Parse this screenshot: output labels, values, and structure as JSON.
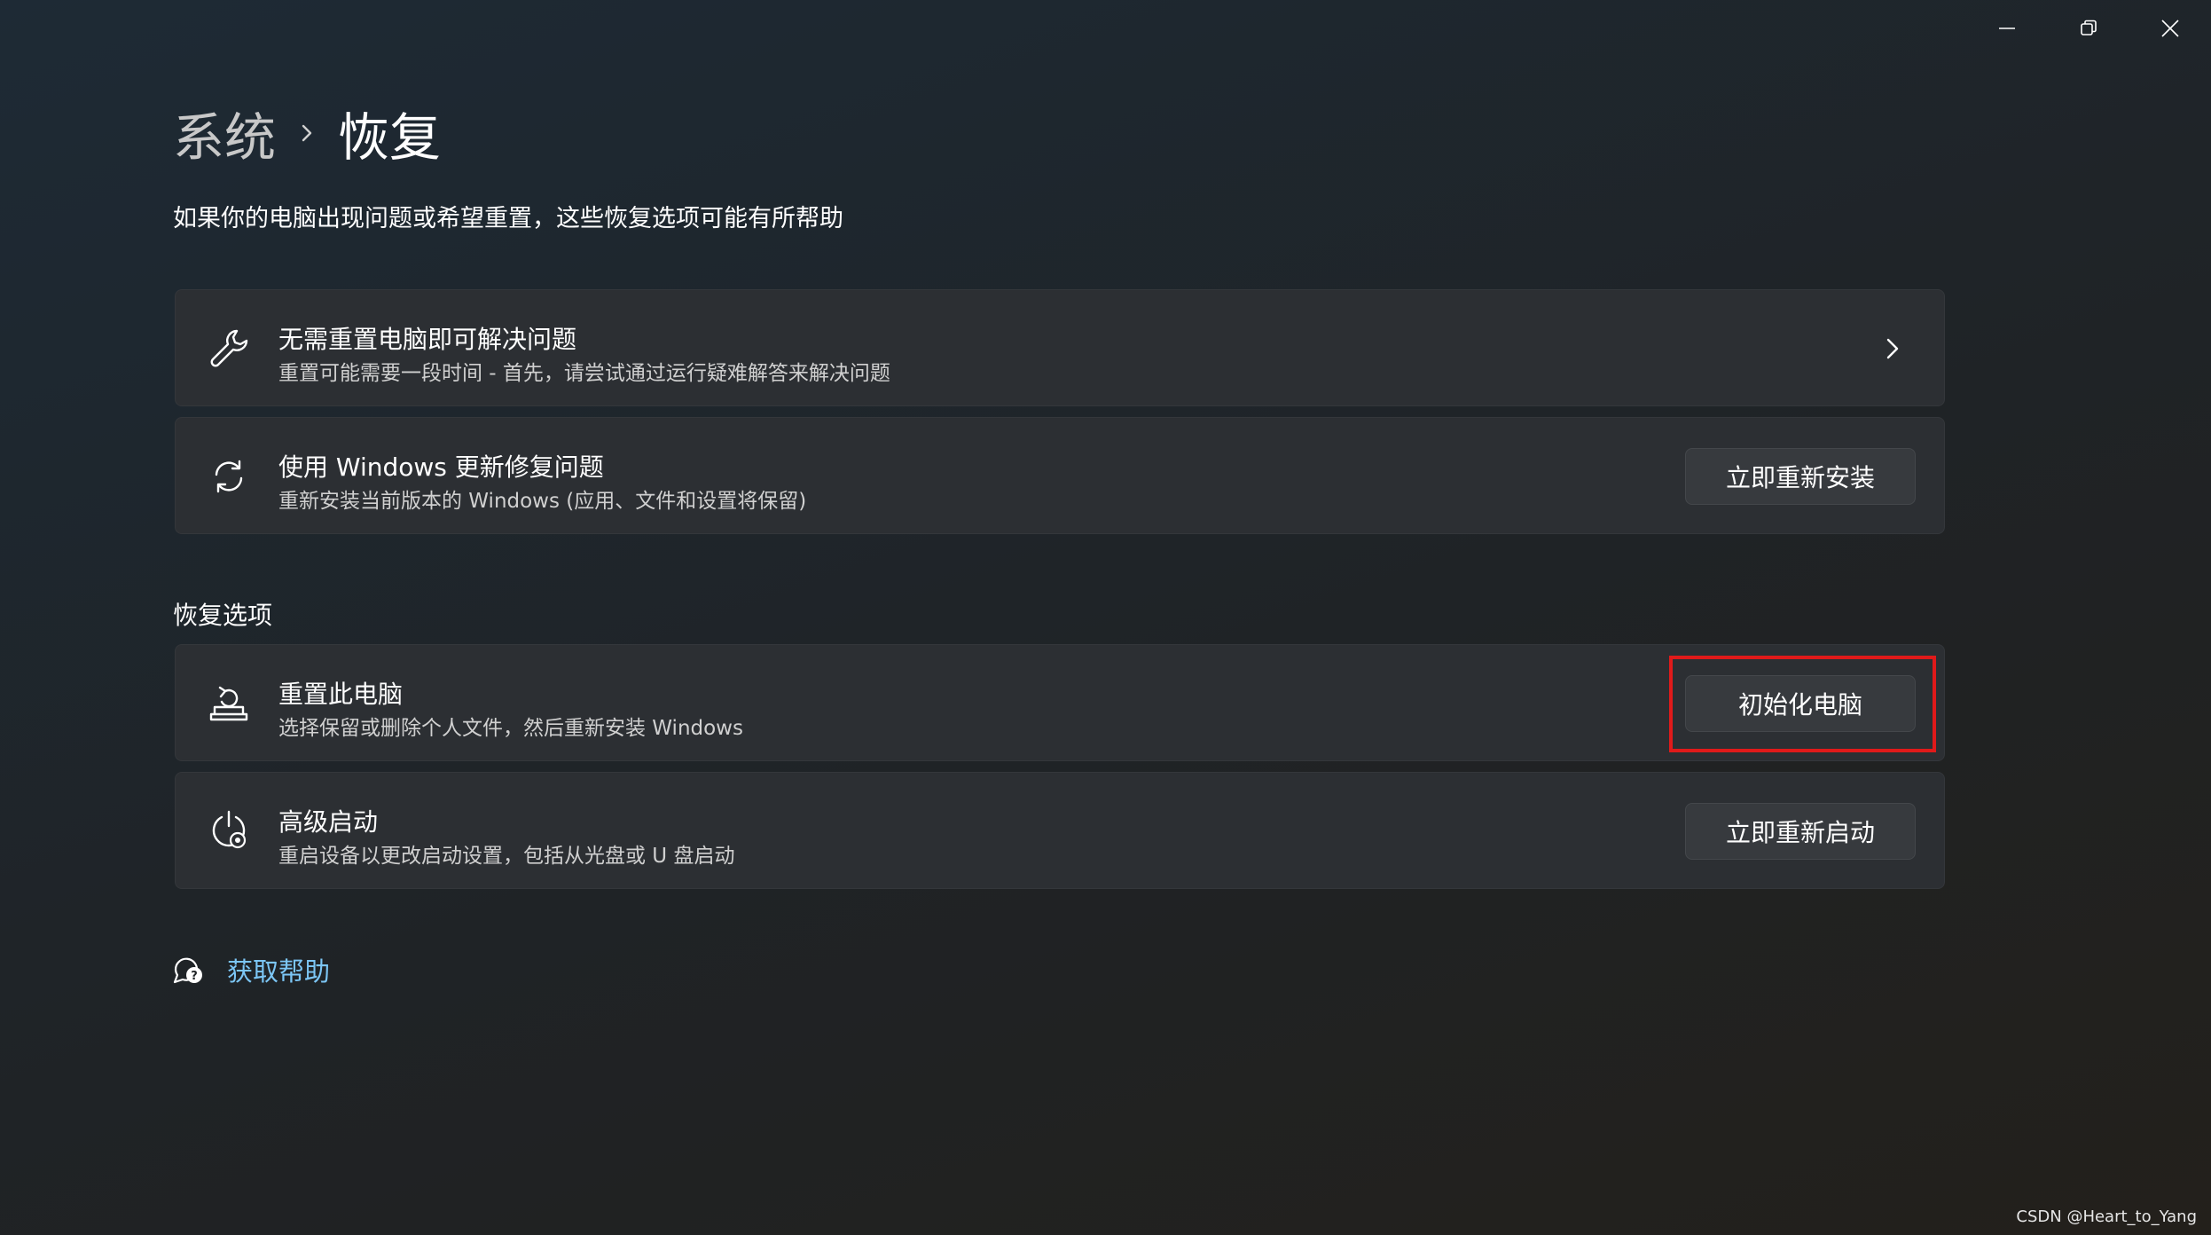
{
  "window_controls": {
    "minimize": "minimize-icon",
    "restore": "restore-icon",
    "close": "close-icon"
  },
  "breadcrumb": {
    "parent": "系统",
    "separator_icon": "chevron-right-icon",
    "current": "恢复"
  },
  "page_description": "如果你的电脑出现问题或希望重置，这些恢复选项可能有所帮助",
  "cards": [
    {
      "icon": "wrench-icon",
      "title": "无需重置电脑即可解决问题",
      "subtitle": "重置可能需要一段时间 - 首先，请尝试通过运行疑难解答来解决问题",
      "action_icon": "chevron-right-icon"
    },
    {
      "icon": "sync-icon",
      "title": "使用 Windows 更新修复问题",
      "subtitle": "重新安装当前版本的 Windows (应用、文件和设置将保留)",
      "button": "立即重新安装"
    }
  ],
  "recovery_section": {
    "heading": "恢复选项",
    "items": [
      {
        "icon": "reset-pc-icon",
        "title": "重置此电脑",
        "subtitle": "选择保留或删除个人文件，然后重新安装 Windows",
        "button": "初始化电脑"
      },
      {
        "icon": "advanced-startup-icon",
        "title": "高级启动",
        "subtitle": "重启设备以更改启动设置，包括从光盘或 U 盘启动",
        "button": "立即重新启动"
      }
    ]
  },
  "help": {
    "icon": "help-chat-icon",
    "label": "获取帮助"
  },
  "watermark": "CSDN @Heart_to_Yang",
  "colors": {
    "background": "#1f2326",
    "card": "#2c2f33",
    "button": "#373a3e",
    "link": "#7cc6f5",
    "highlight": "#e01a1a"
  }
}
